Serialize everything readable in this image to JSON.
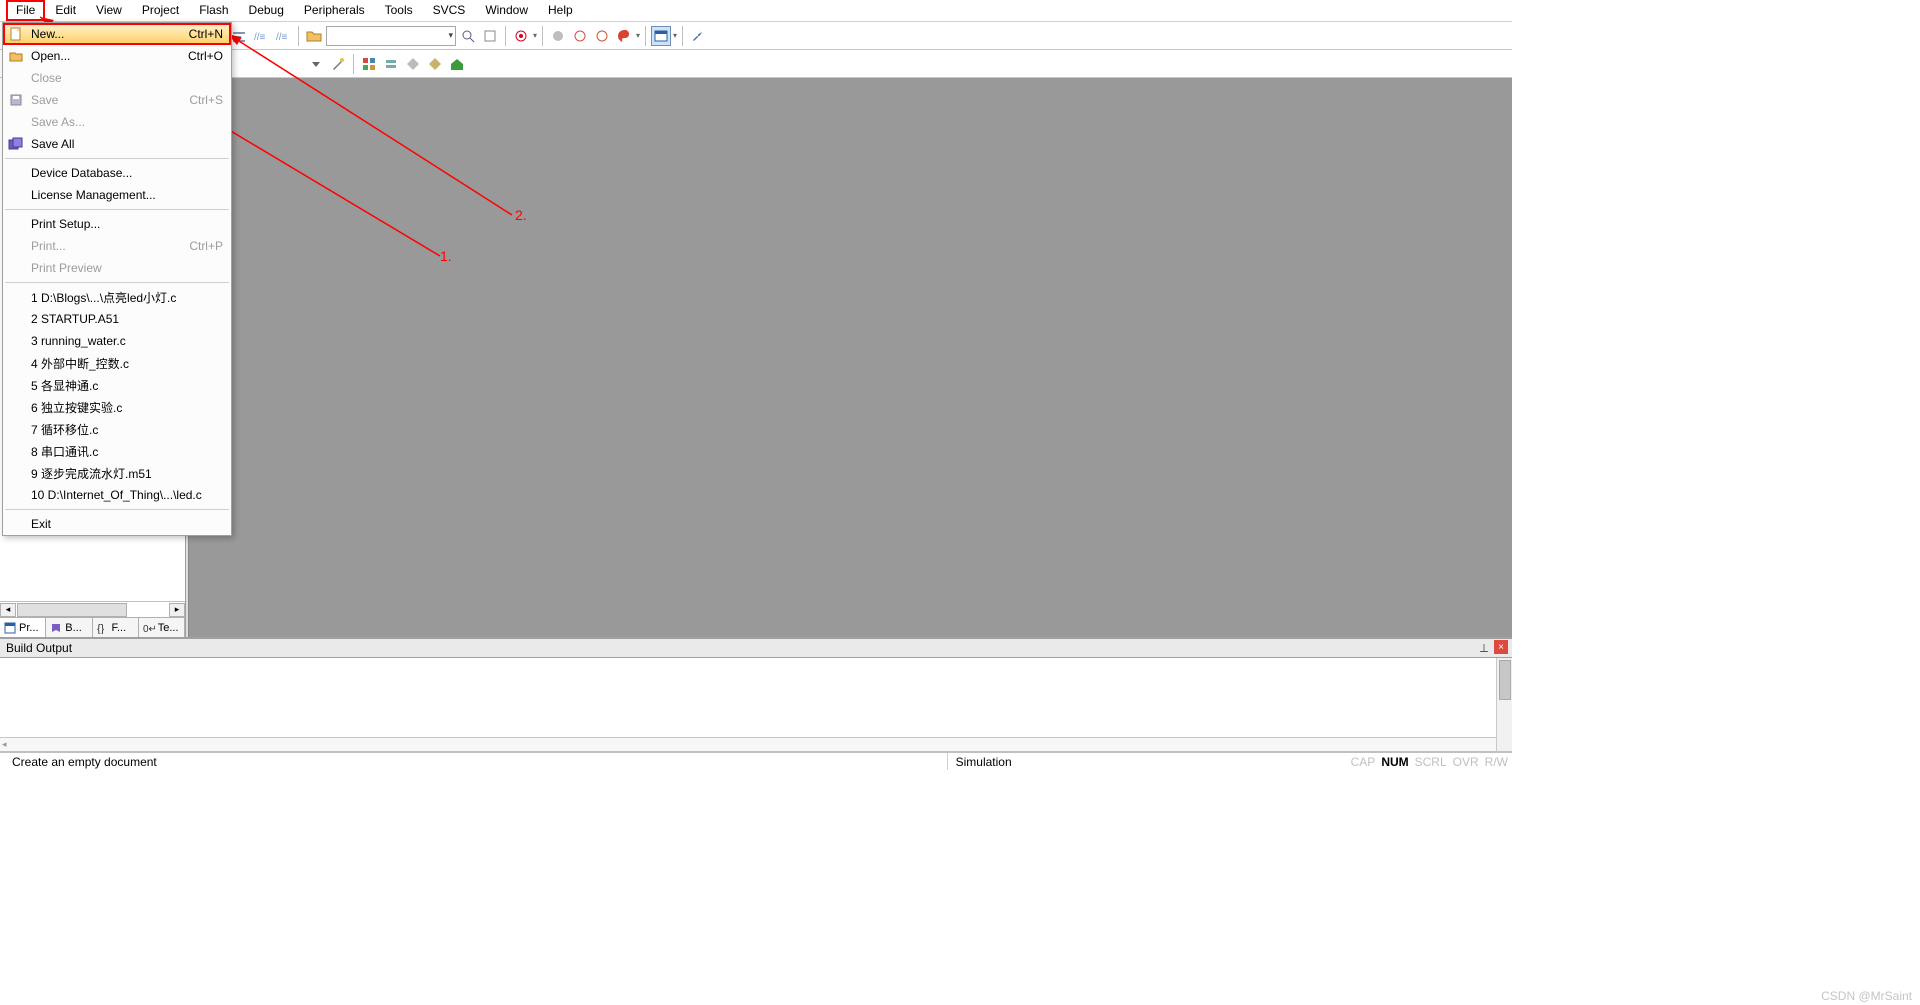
{
  "menubar": [
    "File",
    "Edit",
    "View",
    "Project",
    "Flash",
    "Debug",
    "Peripherals",
    "Tools",
    "SVCS",
    "Window",
    "Help"
  ],
  "file_menu": {
    "sections": [
      [
        {
          "label": "New...",
          "shortcut": "Ctrl+N",
          "icon": "newfile",
          "enabled": true,
          "highlight": true
        },
        {
          "label": "Open...",
          "shortcut": "Ctrl+O",
          "icon": "openfolder",
          "enabled": true
        },
        {
          "label": "Close",
          "shortcut": "",
          "icon": "",
          "enabled": false
        },
        {
          "label": "Save",
          "shortcut": "Ctrl+S",
          "icon": "save",
          "enabled": false
        },
        {
          "label": "Save As...",
          "shortcut": "",
          "icon": "",
          "enabled": false
        },
        {
          "label": "Save All",
          "shortcut": "",
          "icon": "saveall",
          "enabled": true
        }
      ],
      [
        {
          "label": "Device Database...",
          "shortcut": "",
          "icon": "",
          "enabled": true
        },
        {
          "label": "License Management...",
          "shortcut": "",
          "icon": "",
          "enabled": true
        }
      ],
      [
        {
          "label": "Print Setup...",
          "shortcut": "",
          "icon": "",
          "enabled": true
        },
        {
          "label": "Print...",
          "shortcut": "Ctrl+P",
          "icon": "",
          "enabled": false
        },
        {
          "label": "Print Preview",
          "shortcut": "",
          "icon": "",
          "enabled": false
        }
      ],
      [
        {
          "label": "1 D:\\Blogs\\...\\点亮led小灯.c",
          "shortcut": "",
          "icon": "",
          "enabled": true
        },
        {
          "label": "2 STARTUP.A51",
          "shortcut": "",
          "icon": "",
          "enabled": true
        },
        {
          "label": "3 running_water.c",
          "shortcut": "",
          "icon": "",
          "enabled": true
        },
        {
          "label": "4 外部中断_控数.c",
          "shortcut": "",
          "icon": "",
          "enabled": true
        },
        {
          "label": "5 各显神通.c",
          "shortcut": "",
          "icon": "",
          "enabled": true
        },
        {
          "label": "6 独立按键实验.c",
          "shortcut": "",
          "icon": "",
          "enabled": true
        },
        {
          "label": "7 循环移位.c",
          "shortcut": "",
          "icon": "",
          "enabled": true
        },
        {
          "label": "8 串口通讯.c",
          "shortcut": "",
          "icon": "",
          "enabled": true
        },
        {
          "label": "9 逐步完成流水灯.m51",
          "shortcut": "",
          "icon": "",
          "enabled": true
        },
        {
          "label": "10 D:\\Internet_Of_Thing\\...\\led.c",
          "shortcut": "",
          "icon": "",
          "enabled": true
        }
      ],
      [
        {
          "label": "Exit",
          "shortcut": "",
          "icon": "",
          "enabled": true
        }
      ]
    ]
  },
  "sidebar_tabs": [
    {
      "label": "Pr...",
      "icon": "doc",
      "active": true
    },
    {
      "label": "B...",
      "icon": "book",
      "active": false
    },
    {
      "label": "F...",
      "icon": "braces",
      "active": false
    },
    {
      "label": "Te...",
      "icon": "tpl",
      "active": false
    }
  ],
  "panel": {
    "title": "Build Output"
  },
  "statusbar": {
    "hint": "Create an empty document",
    "mode": "Simulation",
    "indicators": [
      "CAP",
      "NUM",
      "SCRL",
      "OVR",
      "R/W"
    ]
  },
  "watermark": "CSDN @MrSaint",
  "annotations": {
    "a1": "1.",
    "a2": "2."
  }
}
